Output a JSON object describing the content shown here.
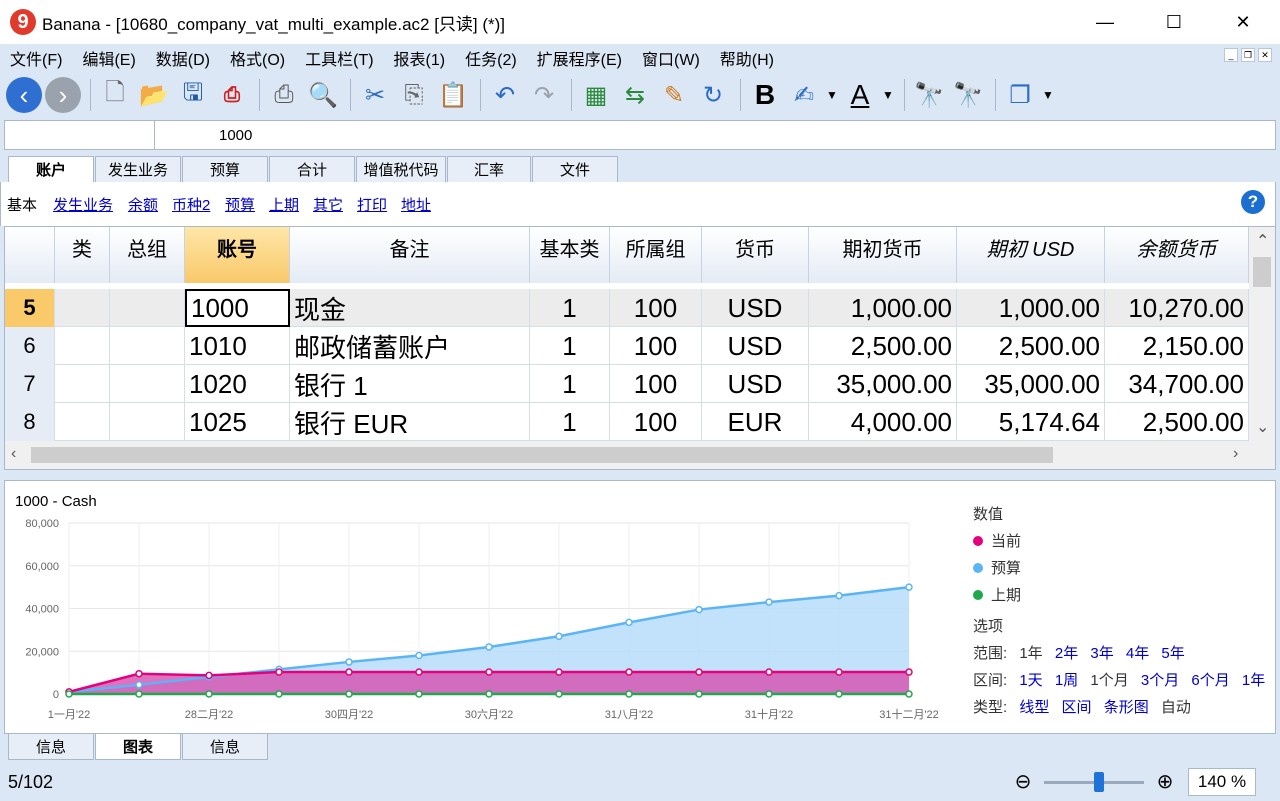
{
  "titlebar": {
    "app_icon": "banana-logo-icon",
    "logo_char": "9",
    "title": "Banana - [10680_company_vat_multi_example.ac2 [只读] (*)]",
    "minimize": "—",
    "maximize": "☐",
    "close": "✕"
  },
  "menu": [
    "文件(F)",
    "编辑(E)",
    "数据(D)",
    "格式(O)",
    "工具栏(T)",
    "报表(1)",
    "任务(2)",
    "扩展程序(E)",
    "窗口(W)",
    "帮助(H)"
  ],
  "formula": {
    "cell_ref": "",
    "value": "1000"
  },
  "top_tabs": [
    "账户",
    "发生业务",
    "预算",
    "合计",
    "增值税代码",
    "汇率",
    "文件"
  ],
  "view_links": [
    "基本",
    "发生业务",
    "余额",
    "币种2",
    "预算",
    "上期",
    "其它",
    "打印",
    "地址"
  ],
  "table": {
    "headers": [
      "类",
      "总组",
      "账号",
      "备注",
      "基本类",
      "所属组",
      "货币",
      "期初货币",
      "期初 USD",
      "余额货币"
    ],
    "rows": [
      {
        "num": "5",
        "cls": "",
        "gr": "",
        "acc": "1000",
        "desc": "现金",
        "bclass": "1",
        "grp": "100",
        "cur": "USD",
        "open_cur": "1,000.00",
        "open_usd": "1,000.00",
        "bal_cur": "10,270.00"
      },
      {
        "num": "6",
        "cls": "",
        "gr": "",
        "acc": "1010",
        "desc": "邮政储蓄账户",
        "bclass": "1",
        "grp": "100",
        "cur": "USD",
        "open_cur": "2,500.00",
        "open_usd": "2,500.00",
        "bal_cur": "2,150.00"
      },
      {
        "num": "7",
        "cls": "",
        "gr": "",
        "acc": "1020",
        "desc": "银行 1",
        "bclass": "1",
        "grp": "100",
        "cur": "USD",
        "open_cur": "35,000.00",
        "open_usd": "35,000.00",
        "bal_cur": "34,700.00"
      },
      {
        "num": "8",
        "cls": "",
        "gr": "",
        "acc": "1025",
        "desc": "银行 EUR",
        "bclass": "1",
        "grp": "100",
        "cur": "EUR",
        "open_cur": "4,000.00",
        "open_usd": "5,174.64",
        "bal_cur": "2,500.00"
      }
    ]
  },
  "chart_panel": {
    "legend_title": "数值",
    "series_labels": [
      "当前",
      "预算",
      "上期"
    ],
    "options_title": "选项",
    "range_label": "范围:",
    "range_opts": [
      "1年",
      "2年",
      "3年",
      "4年",
      "5年"
    ],
    "interval_label": "区间:",
    "interval_opts": [
      "1天",
      "1周",
      "1个月",
      "3个月",
      "6个月",
      "1年"
    ],
    "type_label": "类型:",
    "type_opts": [
      "线型",
      "区间",
      "条形图",
      "自动"
    ]
  },
  "chart_data": {
    "type": "area",
    "title": "1000 - Cash",
    "x": [
      "1-Jan-22",
      "31-Jan-22",
      "28-Feb-22",
      "31-Mar-22",
      "30-Apr-22",
      "31-May-22",
      "30-Jun-22",
      "31-Jul-22",
      "31-Aug-22",
      "30-Sep-22",
      "31-Oct-22",
      "30-Nov-22",
      "31-Dec-22"
    ],
    "x_tick_labels": [
      "1一月'22",
      "28二月'22",
      "30四月'22",
      "30六月'22",
      "31八月'22",
      "31十月'22",
      "31十二月'22"
    ],
    "x_tick_index": [
      0,
      2,
      4,
      6,
      8,
      10,
      12
    ],
    "y_ticks": [
      "0",
      "20,000",
      "40,000",
      "60,000",
      "80,000"
    ],
    "ylim": [
      0,
      80000
    ],
    "grid": true,
    "legend_position": "right",
    "series": [
      {
        "name": "当前",
        "color": "#e6007e",
        "fill": "#d44fb0",
        "values": [
          1000,
          9500,
          8700,
          10270,
          10270,
          10270,
          10270,
          10270,
          10270,
          10270,
          10270,
          10270,
          10270
        ]
      },
      {
        "name": "预算",
        "color": "#5bb5f5",
        "fill": "#b7dcfa",
        "values": [
          1000,
          4300,
          8000,
          11500,
          15000,
          18000,
          22000,
          27000,
          33500,
          39500,
          43000,
          46000,
          50000
        ]
      },
      {
        "name": "上期",
        "color": "#1fa84a",
        "fill": "#1fa84a",
        "values": [
          0,
          0,
          0,
          0,
          0,
          0,
          0,
          0,
          0,
          0,
          0,
          0,
          0
        ]
      }
    ]
  },
  "bottom_tabs": [
    "信息",
    "图表",
    "信息"
  ],
  "status": {
    "row_count": "5/102",
    "zoom": "140 %"
  }
}
